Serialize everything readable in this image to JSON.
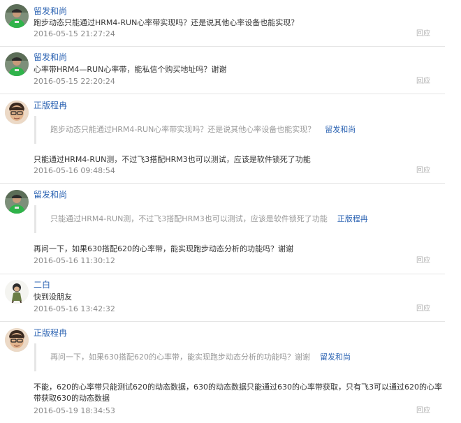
{
  "comments": [
    {
      "user": "留发和尚",
      "avatar": "avatar-green-runner",
      "text": "跑步动态只能通过HRM4-RUN心率带实现吗？还是说其他心率设备也能实现？",
      "time": "2016-05-15 21:27:24",
      "reply": "回应"
    },
    {
      "user": "留发和尚",
      "avatar": "avatar-green-runner",
      "text": "心率带HRM4—RUN心率带，能私信个购买地址吗？谢谢",
      "time": "2016-05-15 22:20:24",
      "reply": "回应"
    },
    {
      "user": "正版程冉",
      "avatar": "avatar-glasses-man",
      "quote_text": "跑步动态只能通过HRM4-RUN心率带实现吗？还是说其他心率设备也能实现？",
      "quote_user": "留发和尚",
      "text": "只能通过HRM4-RUN测，不过飞3搭配HRM3也可以测试，应该是软件锁死了功能",
      "time": "2016-05-16 09:48:54",
      "reply": "回应"
    },
    {
      "user": "留发和尚",
      "avatar": "avatar-green-runner",
      "quote_text": "只能通过HRM4-RUN测，不过飞3搭配HRM3也可以测试，应该是软件锁死了功能",
      "quote_user": "正版程冉",
      "text": "再问一下，如果630搭配620的心率带，能实现跑步动态分析的功能吗？谢谢",
      "time": "2016-05-16 11:30:12",
      "reply": "回应"
    },
    {
      "user": "二白",
      "avatar": "avatar-cartoon-figure",
      "text": "快到没朋友",
      "time": "2016-05-16 13:42:32",
      "reply": "回应"
    },
    {
      "user": "正版程冉",
      "avatar": "avatar-glasses-man",
      "quote_text": "再问一下，如果630搭配620的心率带，能实现跑步动态分析的功能吗？谢谢",
      "quote_user": "留发和尚",
      "text": "不能，620的心率带只能测试620的动态数据，630的动态数据只能通过630的心率带获取，只有飞3可以通过620的心率带获取630的动态数据",
      "time": "2016-05-19 18:34:53",
      "reply": "回应"
    }
  ],
  "colors": {
    "link": "#2d64b3",
    "time": "#888888",
    "reply": "#b0b0b0",
    "quote": "#999999",
    "divider": "#e5e5e5"
  }
}
